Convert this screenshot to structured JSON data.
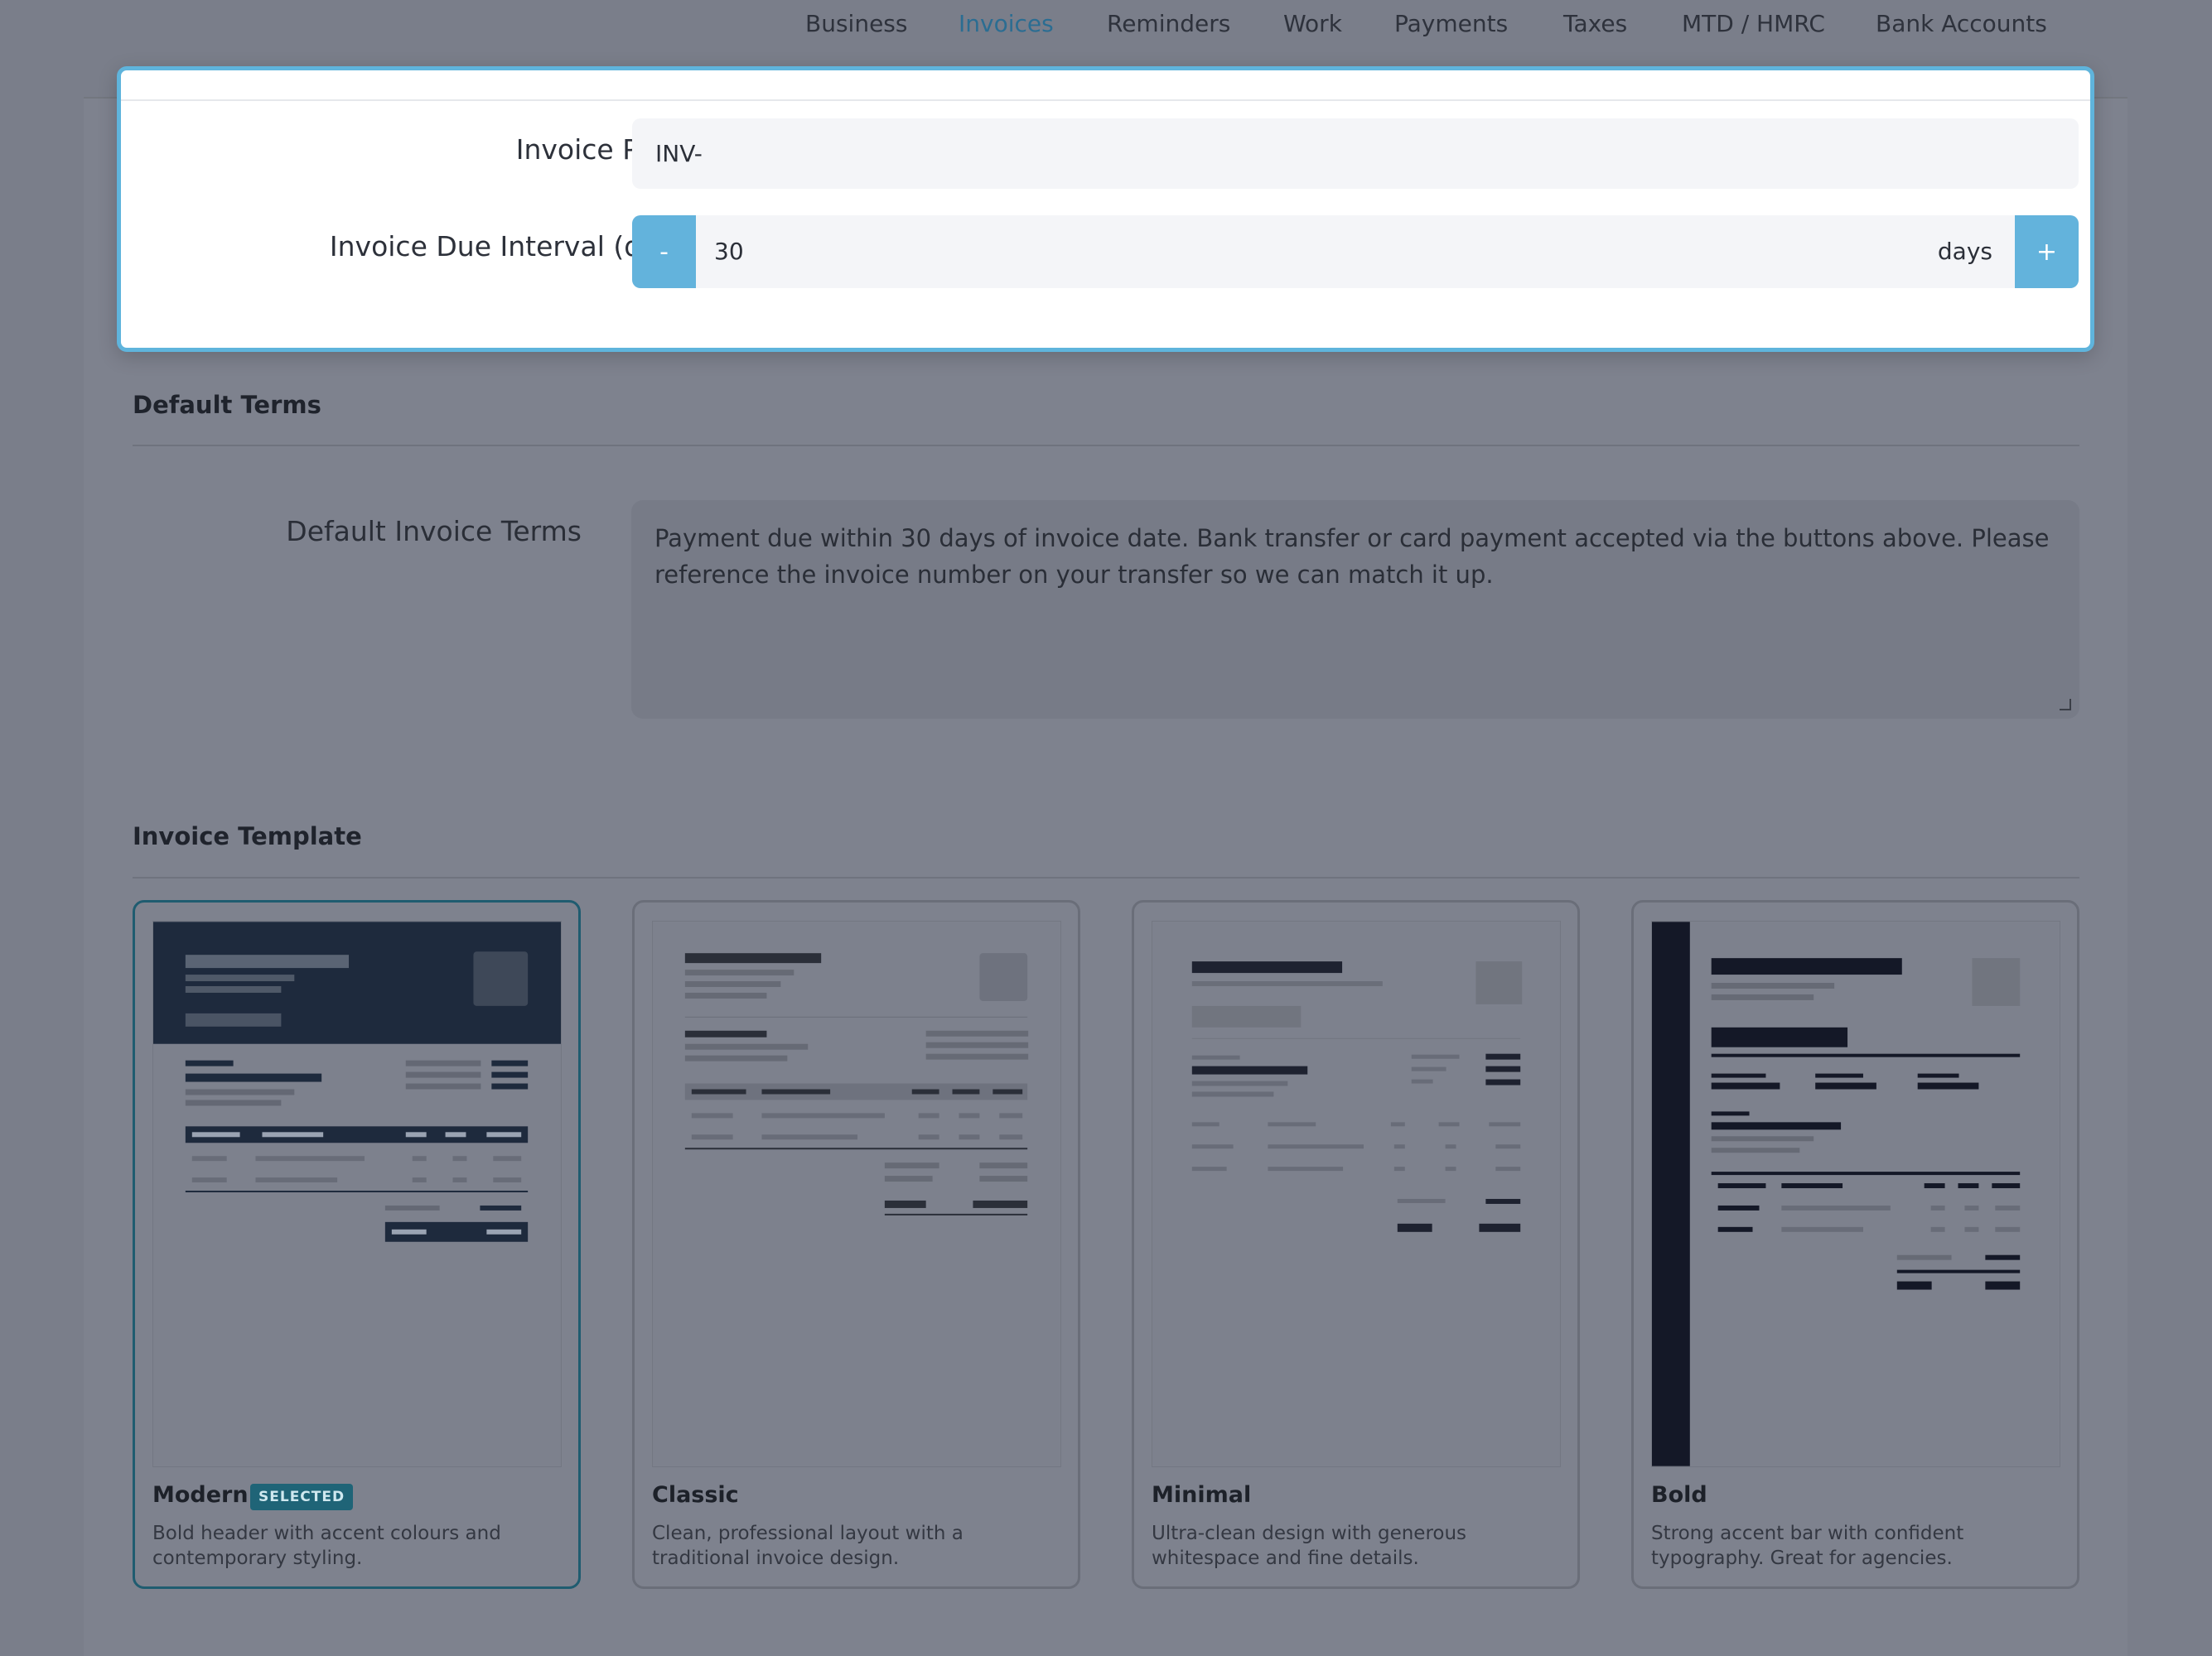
{
  "nav": {
    "items": [
      "Business",
      "Invoices",
      "Reminders",
      "Work",
      "Payments",
      "Taxes",
      "MTD / HMRC",
      "Bank Accounts"
    ],
    "active": "Invoices"
  },
  "modal": {
    "prefix_label": "Invoice Prefix",
    "prefix_value": "INV-",
    "due_label": "Invoice Due Interval (days)",
    "due_value": "30",
    "due_unit": "days",
    "minus_label": "-",
    "plus_label": "+"
  },
  "terms": {
    "section_title": "Default Terms",
    "field_label": "Default Invoice Terms",
    "value": "Payment due within 30 days of invoice date. Bank transfer or card payment accepted via the buttons above. Please reference the invoice number on your transfer so we can match it up."
  },
  "templates": {
    "section_title": "Invoice Template",
    "cards": [
      {
        "name": "Modern",
        "badge": "SELECTED",
        "description": "Bold header with accent colours and contemporary styling."
      },
      {
        "name": "Classic",
        "badge": "",
        "description": "Clean, professional layout with a traditional invoice design."
      },
      {
        "name": "Minimal",
        "badge": "",
        "description": "Ultra-clean design with generous whitespace and fine details."
      },
      {
        "name": "Bold",
        "badge": "",
        "description": "Strong accent bar with confident typography. Great for agencies."
      }
    ]
  },
  "colors": {
    "accent": "#63b3dc",
    "active_nav": "#2b6d92",
    "selected_border": "#1f5c70",
    "dark_navy": "#1e2a3d"
  }
}
